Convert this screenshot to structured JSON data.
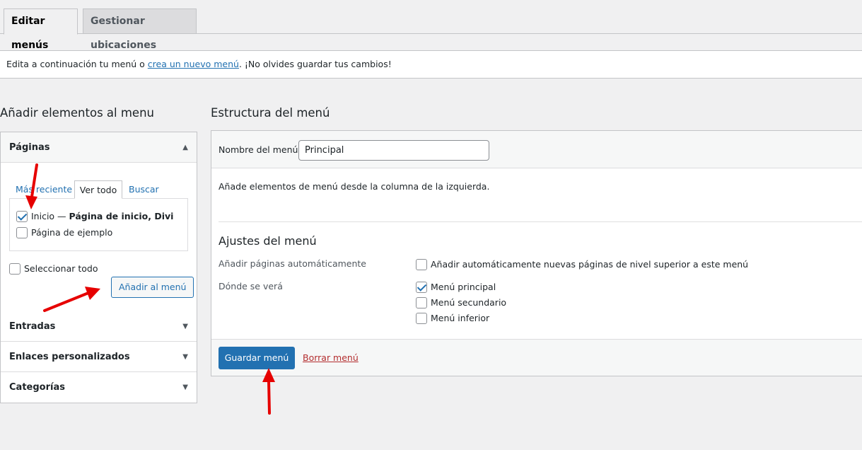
{
  "tabs": {
    "edit": "Editar menús",
    "locations": "Gestionar ubicaciones"
  },
  "notice": {
    "before": "Edita a continuación tu menú o ",
    "link": "crea un nuevo menú",
    "after": ". ¡No olvides guardar tus cambios!"
  },
  "left": {
    "title": "Añadir elementos al menu",
    "pages_title": "Páginas",
    "subtabs": [
      "Más reciente",
      "Ver todo",
      "Buscar"
    ],
    "items": [
      {
        "label": "Inicio — ",
        "bold": "Página de inicio, Divi",
        "checked": true
      },
      {
        "label": "Página de ejemplo",
        "bold": "",
        "checked": false
      }
    ],
    "select_all": "Seleccionar todo",
    "add_button": "Añadir al menú",
    "sections": [
      "Entradas",
      "Enlaces personalizados",
      "Categorías"
    ]
  },
  "right": {
    "title": "Estructura del menú",
    "name_label": "Nombre del menú",
    "name_value": "Principal",
    "hint": "Añade elementos de menú desde la columna de la izquierda.",
    "settings_title": "Ajustes del menú",
    "auto_label": "Añadir páginas automáticamente",
    "auto_option": "Añadir automáticamente nuevas páginas de nivel superior a este menú",
    "location_label": "Dónde se verá",
    "locations": [
      {
        "label": "Menú principal",
        "checked": true
      },
      {
        "label": "Menú secundario",
        "checked": false
      },
      {
        "label": "Menú inferior",
        "checked": false
      }
    ],
    "save_button": "Guardar menú",
    "delete_link": "Borrar menú"
  },
  "colors": {
    "accent": "#2271b1",
    "danger": "#b32d2e",
    "annotation": "#e60000"
  }
}
